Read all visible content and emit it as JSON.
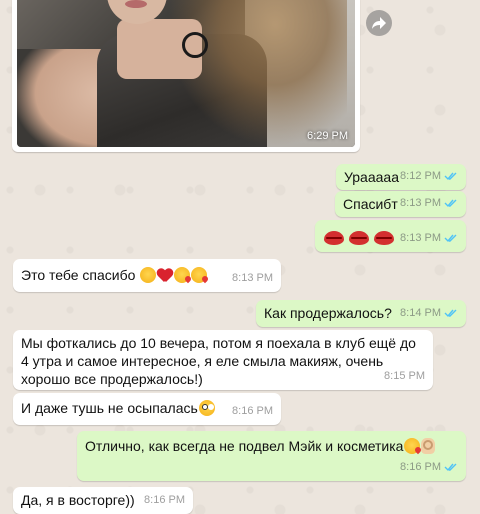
{
  "colors": {
    "chat_background": "#ece5dd",
    "outgoing_bubble": "#dcf8c6",
    "incoming_bubble": "#ffffff",
    "read_ticks": "#4fc3f7"
  },
  "image_message": {
    "time": "6:29 PM",
    "photo_icon": "photo-selfie",
    "forward_icon": "forward-arrow-icon"
  },
  "messages": [
    {
      "direction": "out",
      "text": "Урааааа",
      "time": "8:12 PM",
      "status": "read"
    },
    {
      "direction": "out",
      "text": "Спасибт",
      "time": "8:13 PM",
      "status": "read"
    },
    {
      "direction": "out",
      "text": "",
      "emojis": [
        "kiss-mark",
        "kiss-mark",
        "kiss-mark"
      ],
      "time": "8:13 PM",
      "status": "read"
    },
    {
      "direction": "in",
      "text": "Это тебе спасибо",
      "emojis": [
        "smiling-face",
        "red-heart",
        "face-blowing-kiss",
        "face-blowing-kiss"
      ],
      "time": "8:13 PM"
    },
    {
      "direction": "out",
      "text": "Как продержалось?",
      "time": "8:14 PM",
      "status": "read"
    },
    {
      "direction": "in",
      "text": "Мы фоткались до 10 вечера, потом я поехала в клуб ещё до 4 утра и самое интересное, я еле смыла макияж, очень хорошо все продержалось!)",
      "time": "8:15 PM"
    },
    {
      "direction": "in",
      "text": "И даже тушь не осыпалась",
      "emojis": [
        "flushed-face"
      ],
      "time": "8:16 PM"
    },
    {
      "direction": "out",
      "text": "Отлично, как всегда не подвел Мэйк и косметика",
      "emojis": [
        "face-blowing-kiss",
        "ok-hand"
      ],
      "time": "8:16 PM",
      "status": "read"
    },
    {
      "direction": "in",
      "text": "Да, я в восторге))",
      "time": "8:16 PM"
    }
  ]
}
